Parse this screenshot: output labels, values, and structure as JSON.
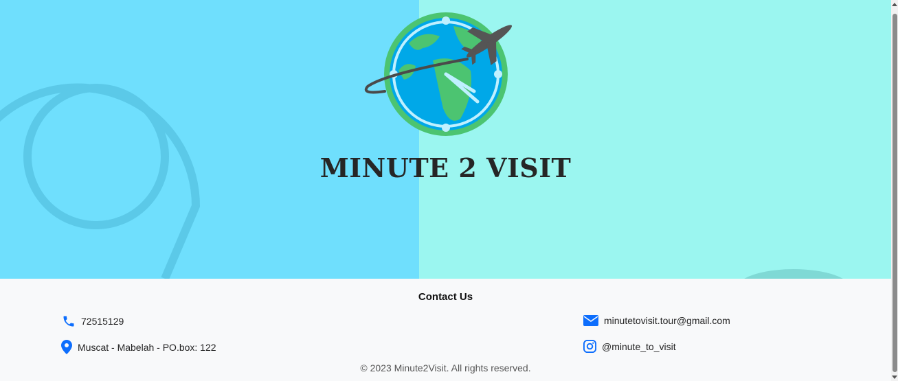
{
  "brand": {
    "name": "MINUTE 2 VISIT"
  },
  "footer": {
    "title": "Contact Us",
    "phone": "72515129",
    "address": "Muscat - Mabelah - PO.box: 122",
    "email": "minutetovisit.tour@gmail.com",
    "instagram": "@minute_to_visit",
    "copyright": "© 2023 Minute2Visit. All rights reserved."
  },
  "colors": {
    "hero_left": "#6fdffd",
    "hero_right": "#9bf6f0",
    "icon_blue": "#0d6efd",
    "footer_bg": "#f8f9fa"
  },
  "icons": [
    "map-pin-icon",
    "globe-logo-icon",
    "phone-icon",
    "location-pin-icon",
    "envelope-icon",
    "instagram-icon"
  ]
}
